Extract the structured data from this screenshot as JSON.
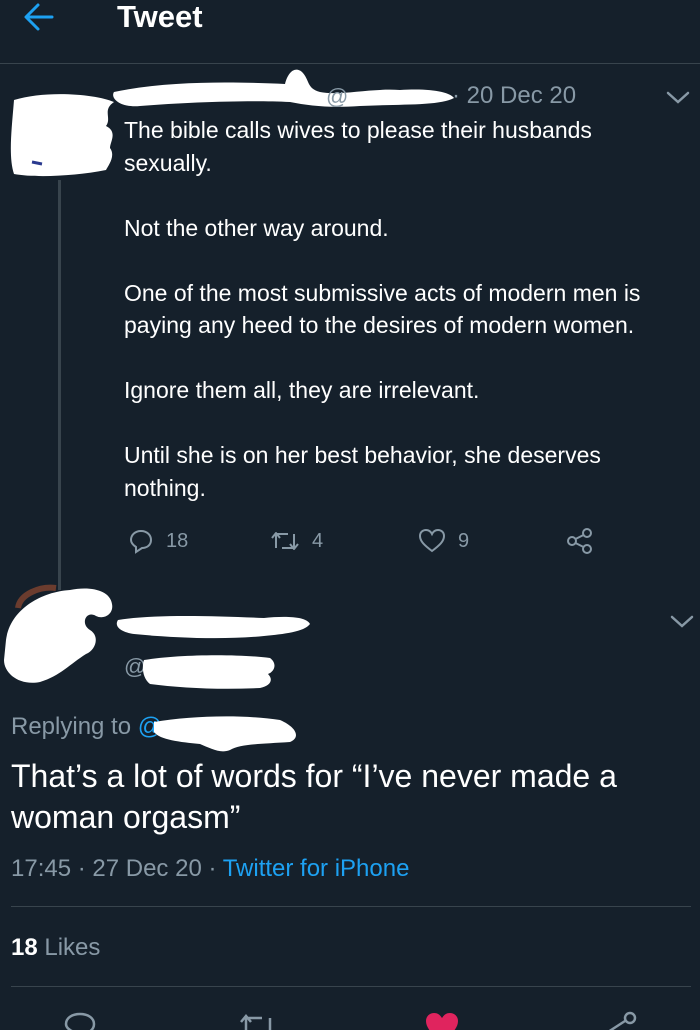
{
  "header": {
    "title": "Tweet",
    "back_icon": "arrow-left-icon"
  },
  "colors": {
    "background": "#15202b",
    "accent": "#1da1f2",
    "muted": "#8899a6",
    "like_active": "#e0245e"
  },
  "parent_tweet": {
    "handle_prefix": "@",
    "date": "· 20 Dec 20",
    "paragraphs": [
      "The bible calls wives to please their husbands sexually.",
      "Not the other way around.",
      "One of the most submissive acts of modern men is paying any heed to the desires of modern women.",
      "Ignore them all, they are irrelevant.",
      "Until she is on her best behavior, she deserves nothing."
    ],
    "replies_count": "18",
    "retweets_count": "4",
    "likes_count": "9"
  },
  "reply_tweet": {
    "handle_prefix": "@",
    "replying_to_label": "Replying to",
    "replying_to_handle": "@",
    "text": "That’s a lot of words for “I’ve never made a woman orgasm”",
    "time": "17:45 · 27 Dec 20 · ",
    "source": "Twitter for iPhone",
    "likes_count": "18",
    "likes_label": "Likes"
  }
}
